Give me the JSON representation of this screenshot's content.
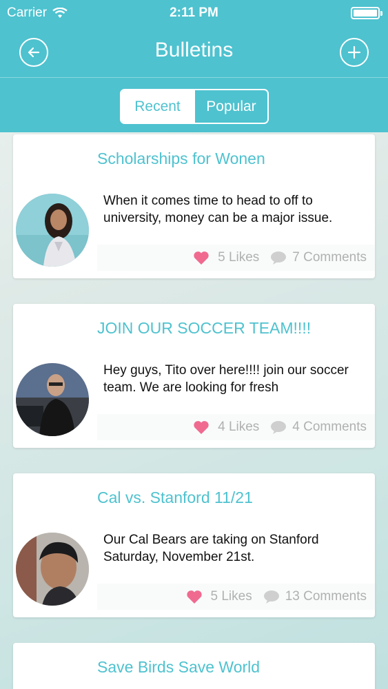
{
  "status": {
    "carrier": "Carrier",
    "time": "2:11 PM"
  },
  "nav": {
    "title": "Bulletins",
    "back_icon": "back-arrow-icon",
    "add_icon": "plus-icon"
  },
  "tabs": {
    "recent": "Recent",
    "popular": "Popular",
    "selected": "Recent"
  },
  "colors": {
    "accent": "#4ec2cf",
    "heart": "#f06a8f",
    "muted": "#b0b0b0"
  },
  "posts": [
    {
      "title": "Scholarships for Wonen",
      "body": "When it comes time to head to off to university, money can be a major issue.",
      "likes": "5 Likes",
      "comments": "7 Comments"
    },
    {
      "title": "JOIN OUR SOCCER TEAM!!!!",
      "body": "Hey guys, Tito over here!!!! join our soccer team.  We are looking for fresh",
      "likes": "4 Likes",
      "comments": "4 Comments"
    },
    {
      "title": "Cal vs. Stanford 11/21",
      "body": "Our Cal Bears are taking on Stanford Saturday, November 21st.",
      "likes": "5 Likes",
      "comments": "13 Comments"
    },
    {
      "title": "Save Birds Save World"
    }
  ]
}
